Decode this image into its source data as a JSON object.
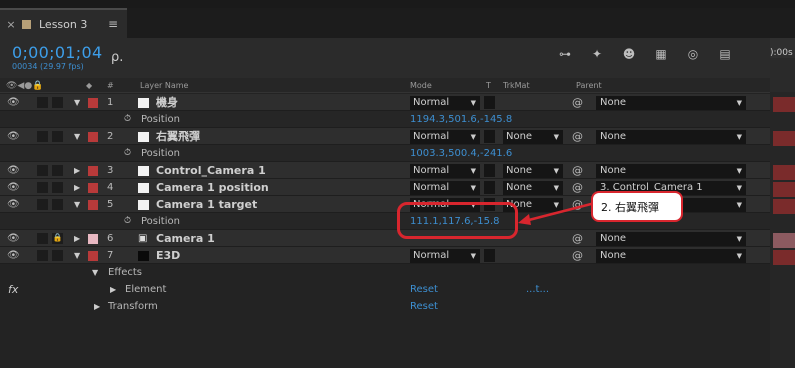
{
  "tab": {
    "close": "×",
    "title": "Lesson 3",
    "menu": "≡"
  },
  "header": {
    "timecode": "0;00;01;04",
    "frames_fps": "00034 (29.97 fps)",
    "search_glyph": "ρ."
  },
  "toolbar_icons": [
    "comp-flowchart-icon",
    "draft-3d-icon",
    "shy-layers-icon",
    "frame-blending-icon",
    "motion-blur-icon",
    "graph-editor-icon"
  ],
  "right_panel": {
    "label": "):00s"
  },
  "columns": {
    "layer_name": "Layer Name",
    "mode": "Mode",
    "t": "T",
    "trkmat": "TrkMat",
    "parent": "Parent",
    "hash": "#"
  },
  "rows": [
    {
      "type": "layer",
      "num": "1",
      "name": "機身",
      "mode": "Normal",
      "trkmat": "",
      "parent": "None",
      "label_color": "#b83a3a",
      "triangle": "▼",
      "src": "white"
    },
    {
      "type": "prop",
      "name": "Position",
      "value": "1194.3,501.6,-145.8"
    },
    {
      "type": "layer",
      "num": "2",
      "name": "右翼飛彈",
      "mode": "Normal",
      "trkmat": "None",
      "parent": "None",
      "label_color": "#b83a3a",
      "triangle": "▼",
      "src": "white"
    },
    {
      "type": "prop",
      "name": "Position",
      "value": "1003.3,500.4,-241.6"
    },
    {
      "type": "layer",
      "num": "3",
      "name": "Control_Camera 1",
      "mode": "Normal",
      "trkmat": "None",
      "parent": "None",
      "label_color": "#b83a3a",
      "triangle": "▶",
      "src": "white"
    },
    {
      "type": "layer",
      "num": "4",
      "name": "Camera 1 position",
      "mode": "Normal",
      "trkmat": "None",
      "parent": "3. Control_Camera 1",
      "label_color": "#b83a3a",
      "triangle": "▶",
      "src": "white"
    },
    {
      "type": "layer",
      "num": "5",
      "name": "Camera 1 target",
      "mode": "Normal",
      "trkmat": "None",
      "parent": "2. 右翼飛彈",
      "label_color": "#b83a3a",
      "triangle": "▼",
      "src": "white"
    },
    {
      "type": "prop",
      "name": "Position",
      "value": "111.1,117.6,-15.8"
    },
    {
      "type": "layer",
      "num": "6",
      "name": "Camera 1",
      "mode": "",
      "trkmat": "",
      "parent": "None",
      "label_color": "#e8b8c2",
      "triangle": "▶",
      "src": "camera",
      "locked": true
    },
    {
      "type": "layer",
      "num": "7",
      "name": "E3D",
      "mode": "Normal",
      "trkmat": "",
      "parent": "None",
      "label_color": "#b83a3a",
      "triangle": "▼",
      "src": "black"
    }
  ],
  "effects": {
    "fx_symbol": "fx",
    "effects_label": "Effects",
    "element_label": "Element",
    "element_reset": "Reset",
    "element_extra": "...t...",
    "transform_label": "Transform",
    "transform_reset": "Reset"
  },
  "annotation": {
    "text": "2. 右翼飛彈"
  },
  "colors": {
    "accent_blue": "#3d9ee9",
    "callout_red": "#d8262e",
    "label_red": "#b83a3a",
    "label_pink": "#e8b8c2"
  }
}
